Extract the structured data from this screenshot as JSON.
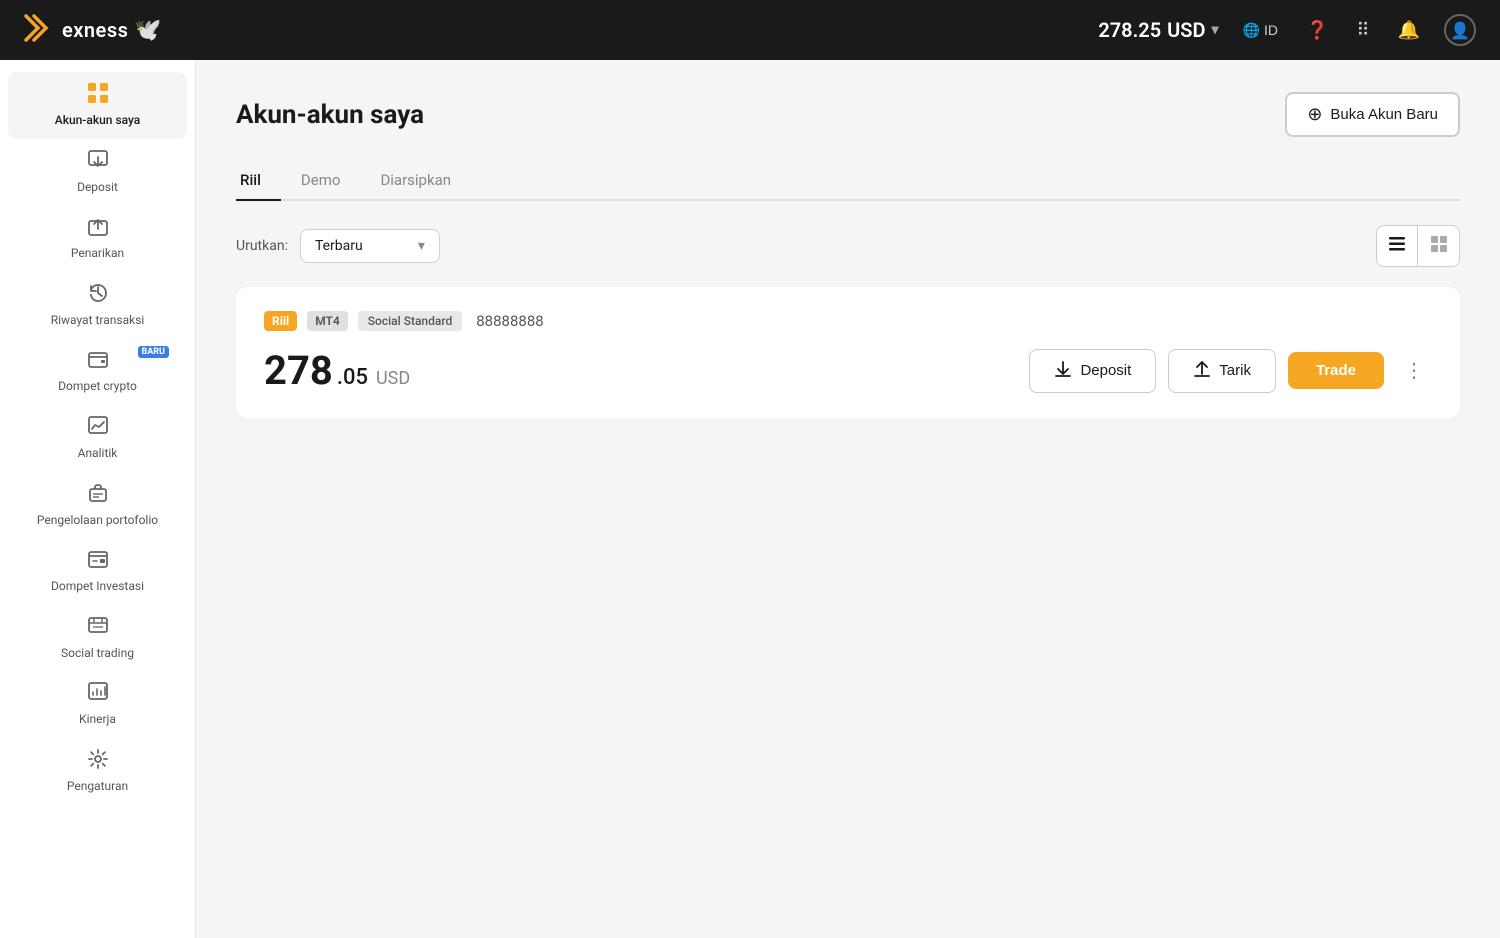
{
  "topnav": {
    "logo_x": "✗",
    "logo_text": "exness",
    "balance": "278.25",
    "currency": "USD",
    "lang": "ID",
    "chevron": "▾"
  },
  "sidebar": {
    "items": [
      {
        "id": "akun-akun-saya",
        "label": "Akun-akun saya",
        "icon": "⊞",
        "active": true,
        "baru": false
      },
      {
        "id": "deposit",
        "label": "Deposit",
        "icon": "⬇",
        "active": false,
        "baru": false
      },
      {
        "id": "penarikan",
        "label": "Penarikan",
        "icon": "⬆",
        "active": false,
        "baru": false
      },
      {
        "id": "riwayat-transaksi",
        "label": "Riwayat transaksi",
        "icon": "⏳",
        "active": false,
        "baru": false
      },
      {
        "id": "dompet-crypto",
        "label": "Dompet crypto",
        "icon": "🗂",
        "active": false,
        "baru": true
      },
      {
        "id": "analitik",
        "label": "Analitik",
        "icon": "📊",
        "active": false,
        "baru": false
      },
      {
        "id": "pengelolaan-portofolio",
        "label": "Pengelolaan portofolio",
        "icon": "💼",
        "active": false,
        "baru": false
      },
      {
        "id": "dompet-investasi",
        "label": "Dompet Investasi",
        "icon": "🗃",
        "active": false,
        "baru": false
      },
      {
        "id": "social-trading",
        "label": "Social trading",
        "icon": "📋",
        "active": false,
        "baru": false
      },
      {
        "id": "kinerja",
        "label": "Kinerja",
        "icon": "🖼",
        "active": false,
        "baru": false
      },
      {
        "id": "pengaturan",
        "label": "Pengaturan",
        "icon": "⚙",
        "active": false,
        "baru": false
      }
    ]
  },
  "content": {
    "page_title": "Akun-akun saya",
    "open_account_btn": "Buka Akun Baru",
    "tabs": [
      {
        "id": "riil",
        "label": "Riil",
        "active": true
      },
      {
        "id": "demo",
        "label": "Demo",
        "active": false
      },
      {
        "id": "diarsipkan",
        "label": "Diarsipkan",
        "active": false
      }
    ],
    "filter": {
      "sort_label": "Urutkan:",
      "sort_value": "Terbaru"
    },
    "account_card": {
      "badge_riil": "Riil",
      "badge_mt4": "MT4",
      "badge_social": "Social Standard",
      "account_number": "88888888",
      "balance_main": "278",
      "balance_dec": ".05",
      "balance_currency": "USD",
      "btn_deposit": "Deposit",
      "btn_tarik": "Tarik",
      "btn_trade": "Trade"
    }
  }
}
